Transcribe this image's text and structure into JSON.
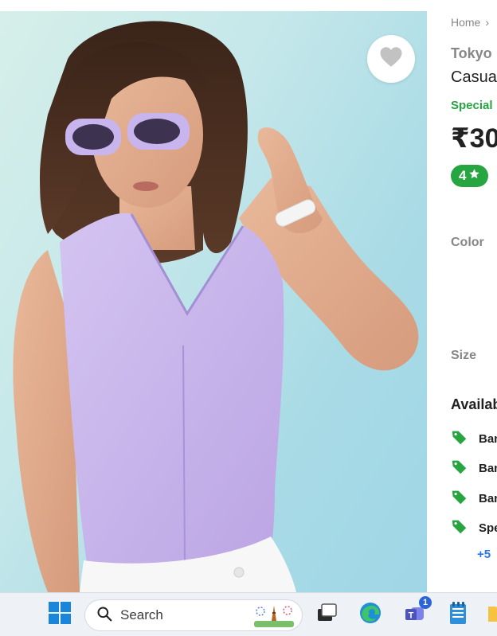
{
  "breadcrumb": {
    "home": "Home",
    "separator": "›"
  },
  "product": {
    "brand": "Tokyo",
    "name": "Casua",
    "special_label": "Special",
    "price": "₹30",
    "rating": "4",
    "rating_icon": "star-icon",
    "wishlist_icon": "heart-icon"
  },
  "sections": {
    "color_label": "Color",
    "size_label": "Size",
    "offers_title": "Availab"
  },
  "offers": [
    {
      "icon": "tag-icon",
      "text": "Ban"
    },
    {
      "icon": "tag-icon",
      "text": "Ban"
    },
    {
      "icon": "tag-icon",
      "text": "Ban"
    },
    {
      "icon": "tag-icon",
      "text": "Spe"
    }
  ],
  "more_offers": "+5",
  "taskbar": {
    "search_placeholder": "Search",
    "teams_badge": "1",
    "icons": [
      "windows-start-icon",
      "search-icon",
      "task-view-icon",
      "edge-icon",
      "teams-icon",
      "notepad-icon",
      "file-explorer-icon"
    ]
  },
  "colors": {
    "accent_green": "#26a541",
    "link_blue": "#2874f0",
    "muted_text": "#878787",
    "blouse_lavender": "#c9b6ea"
  }
}
